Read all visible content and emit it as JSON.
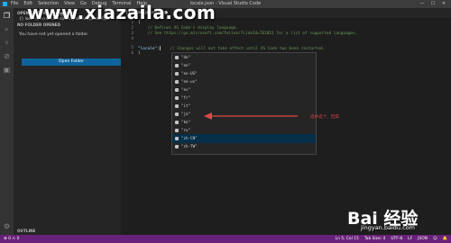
{
  "titlebar": {
    "menu": [
      "File",
      "Edit",
      "Selection",
      "View",
      "Go",
      "Debug",
      "Terminal",
      "Help"
    ],
    "window_title": "locale.json - Visual Studio Code",
    "controls": [
      "—",
      "☐",
      "✕"
    ]
  },
  "sidebar": {
    "open_editors": "OPEN EDITORS",
    "unsaved_badge": "1 UNSAVED",
    "open_file": "{} locale.json  C:\\Users\\runnginlaz\\AppData\\Ro...",
    "no_folder_header": "NO FOLDER OPENED",
    "no_folder_msg": "You have not yet opened a folder.",
    "open_folder_btn": "Open Folder",
    "outline": "OUTLINE"
  },
  "tab": {
    "label": "{} locale.json",
    "close": "●"
  },
  "editor": {
    "lines": [
      {
        "n": "1",
        "text": "{"
      },
      {
        "n": "2",
        "text": "    // Defines VS Code's display language."
      },
      {
        "n": "3",
        "text": "    // See https://go.microsoft.com/fwlink/?LinkId=761051 for a list of supported languages."
      },
      {
        "n": "4",
        "text": ""
      },
      {
        "n": "5",
        "key": "\"locale\"",
        "after": ":",
        "comment": "// Changes will not take effect until VS Code has been restarted."
      },
      {
        "n": "6",
        "text": "}"
      }
    ]
  },
  "suggest": {
    "items": [
      "\"de\"",
      "\"en\"",
      "\"en-US\"",
      "\"en-us\"",
      "\"es\"",
      "\"fr\"",
      "\"it\"",
      "\"ja\"",
      "\"ko\"",
      "\"ru\"",
      "\"zh-CN\"",
      "\"zh-TW\""
    ],
    "selected_index": 10
  },
  "annotation": {
    "text": "选中这个，回车",
    "color": "#e04848"
  },
  "watermark": {
    "url": "www.xiazaila.com",
    "baidu": "Bai  经验",
    "baidu_sub": "jingyan.baidu.com"
  },
  "statusbar": {
    "left": "⊗ 0  ⚠ 0",
    "right": [
      "Ln 5, Col 15",
      "Tab Size: 4",
      "UTF-8",
      "LF",
      "JSON",
      "☺",
      "🔔"
    ]
  },
  "colors": {
    "statusbar": "#68217a",
    "button": "#0e639c",
    "selection": "#062f4a"
  }
}
